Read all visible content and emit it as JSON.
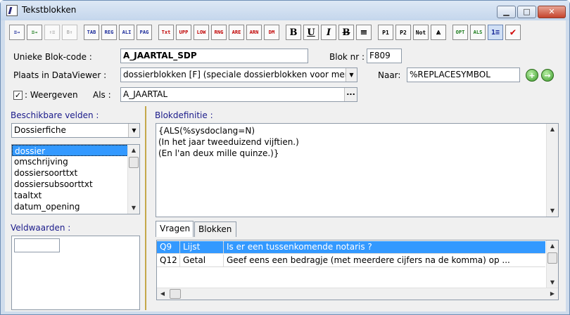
{
  "window": {
    "title": "Tekstblokken",
    "minimize": "▁",
    "maximize": "□",
    "close": "✕"
  },
  "toolbar": {
    "buttons": [
      {
        "name": "insert-field-left",
        "glyph": "≡→"
      },
      {
        "name": "insert-field-right",
        "glyph": "≡→"
      },
      {
        "name": "move-up-disabled",
        "glyph": "↑≡"
      },
      {
        "name": "move-down-disabled",
        "glyph": "B↑"
      },
      {
        "name": "tab",
        "glyph": "TAB"
      },
      {
        "name": "reg",
        "glyph": "REG"
      },
      {
        "name": "ali",
        "glyph": "ALI"
      },
      {
        "name": "pag",
        "glyph": "PAG"
      },
      {
        "name": "txt",
        "glyph": "Txt"
      },
      {
        "name": "upp",
        "glyph": "UPP"
      },
      {
        "name": "low",
        "glyph": "LOW"
      },
      {
        "name": "rng",
        "glyph": "RNG"
      },
      {
        "name": "are",
        "glyph": "ARE"
      },
      {
        "name": "arn",
        "glyph": "ARN"
      },
      {
        "name": "dm",
        "glyph": "DM"
      },
      {
        "name": "bold",
        "glyph": "B"
      },
      {
        "name": "underline",
        "glyph": "U"
      },
      {
        "name": "italic",
        "glyph": "I"
      },
      {
        "name": "strike",
        "glyph": "B"
      },
      {
        "name": "align",
        "glyph": "≡"
      },
      {
        "name": "p1",
        "glyph": "P1"
      },
      {
        "name": "p2",
        "glyph": "P2"
      },
      {
        "name": "not",
        "glyph": "Not"
      },
      {
        "name": "arrow-up-box",
        "glyph": "⩓"
      },
      {
        "name": "opt",
        "glyph": "OPT"
      },
      {
        "name": "als",
        "glyph": "ALS"
      },
      {
        "name": "list",
        "glyph": "1≡"
      },
      {
        "name": "confirm",
        "glyph": "✔"
      }
    ]
  },
  "form": {
    "blokcode_label": "Unieke Blok-code :",
    "blokcode_value": "A_JAARTAL_SDP",
    "bloknr_label": "Blok nr :",
    "bloknr_value": "F809",
    "plaats_label": "Plaats in DataViewer :",
    "plaats_value": "dossierblokken [F] (speciale dossierblokken voor merge",
    "naar_label": "Naar:",
    "naar_value": "%REPLACESYMBOL",
    "weergeven_check": "✓",
    "weergeven_label": ": Weergeven",
    "als_label": "Als :",
    "als_value": "A_JAARTAL",
    "als_btn": "..."
  },
  "left": {
    "velden_label": "Beschikbare velden :",
    "velden_dropdown": "Dossierfiche",
    "velden_list": [
      "dossier",
      "omschrijving",
      "dossiersoorttxt",
      "dossiersubsoorttxt",
      "taaltxt",
      "datum_opening"
    ],
    "veldwaarden_label": "Veldwaarden :"
  },
  "right": {
    "blokdef_label": "Blokdefinitie :",
    "blokdef_lines": [
      "{ALS(%sysdoclang=N)",
      "(In het jaar tweeduizend vijftien.)",
      "(En l'an deux mille quinze.)}"
    ],
    "tabs": [
      "Vragen",
      "Blokken"
    ],
    "rows": [
      {
        "id": "Q9",
        "type": "Lijst",
        "text": "Is er een tussenkomende notaris ?"
      },
      {
        "id": "Q12",
        "type": "Getal",
        "text": "Geef eens een bedragje (met meerdere cijfers na de komma) op ..."
      }
    ]
  },
  "colors": {
    "selection": "#3399ff",
    "accent_green": "#3a9a2a",
    "toolbar_red": "#c00000"
  }
}
